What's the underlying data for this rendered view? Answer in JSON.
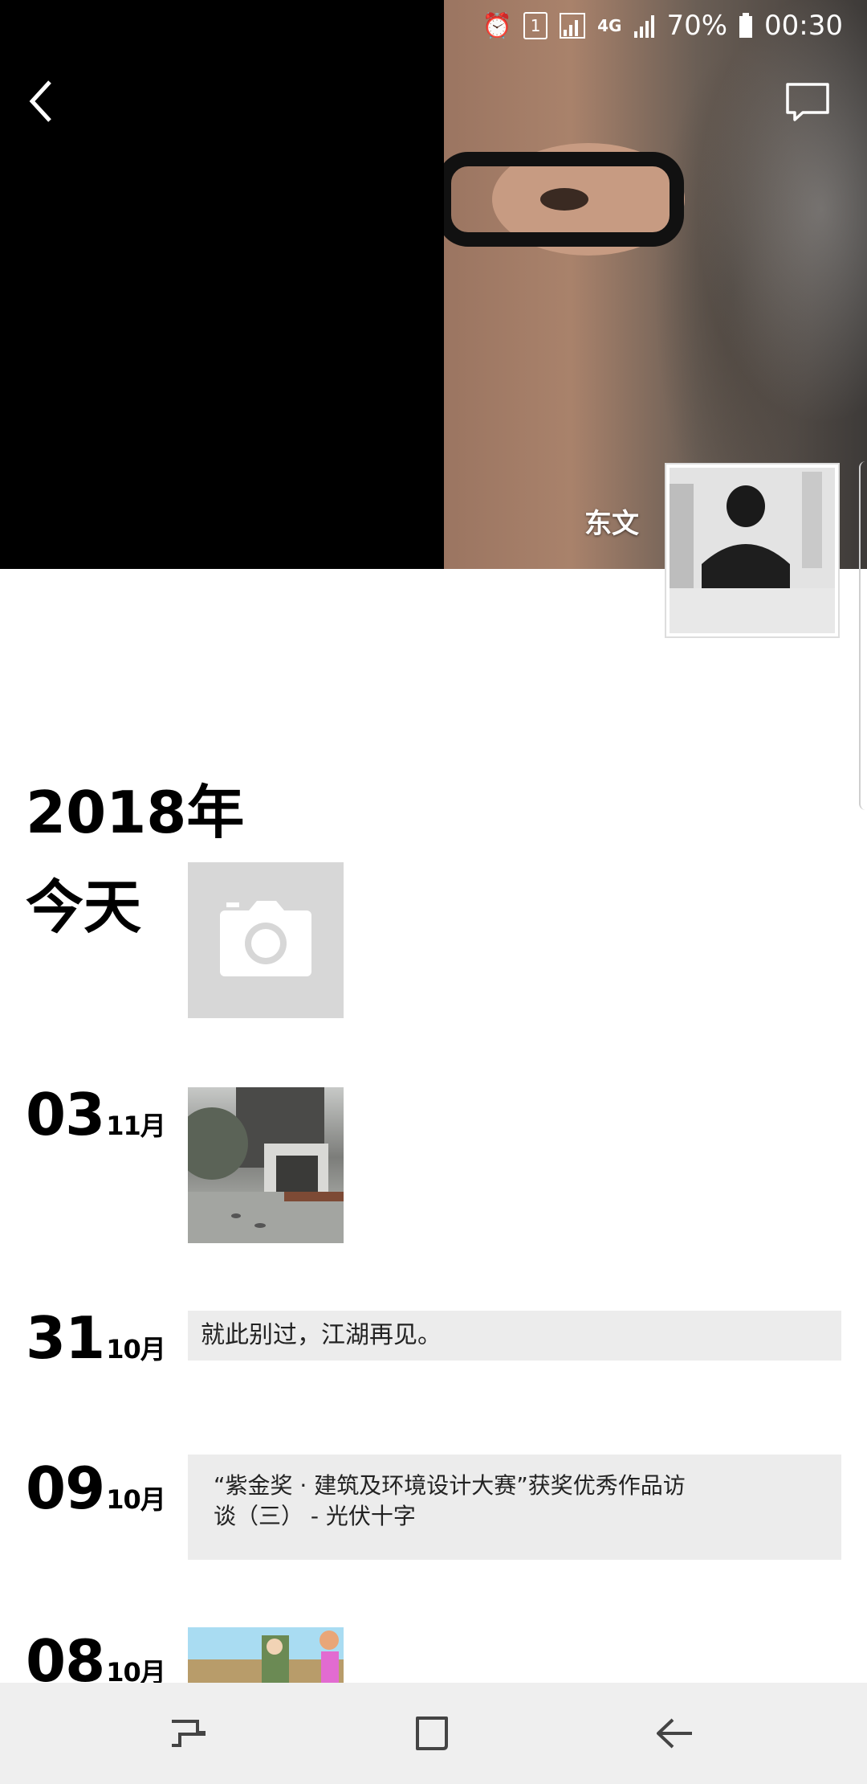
{
  "status_bar": {
    "icons": [
      "alarm-icon",
      "sim-1-icon",
      "signal-icon",
      "4g-icon",
      "signal-icon"
    ],
    "sim_label": "1",
    "network": "4G",
    "battery": "70%",
    "time": "00:30"
  },
  "header": {
    "back_icon": "chevron-left-icon",
    "comment_icon": "comment-bubble-icon"
  },
  "profile": {
    "name": "东文"
  },
  "timeline": {
    "year": "2018年",
    "today_label": "今天",
    "today_icon": "camera-icon",
    "entries": [
      {
        "day": "03",
        "month": "11月",
        "type": "image"
      },
      {
        "day": "31",
        "month": "10月",
        "type": "text",
        "text": "就此别过，江湖再见。"
      },
      {
        "day": "09",
        "month": "10月",
        "type": "text",
        "lines": [
          "“紫金奖 · 建筑及环境设计大赛”获奖优秀作品访",
          "谈（三） - 光伏十字"
        ]
      },
      {
        "day": "08",
        "month": "10月",
        "type": "image"
      }
    ]
  },
  "nav_bar": {
    "icons": [
      "recent-apps-icon",
      "home-icon",
      "back-icon"
    ]
  }
}
